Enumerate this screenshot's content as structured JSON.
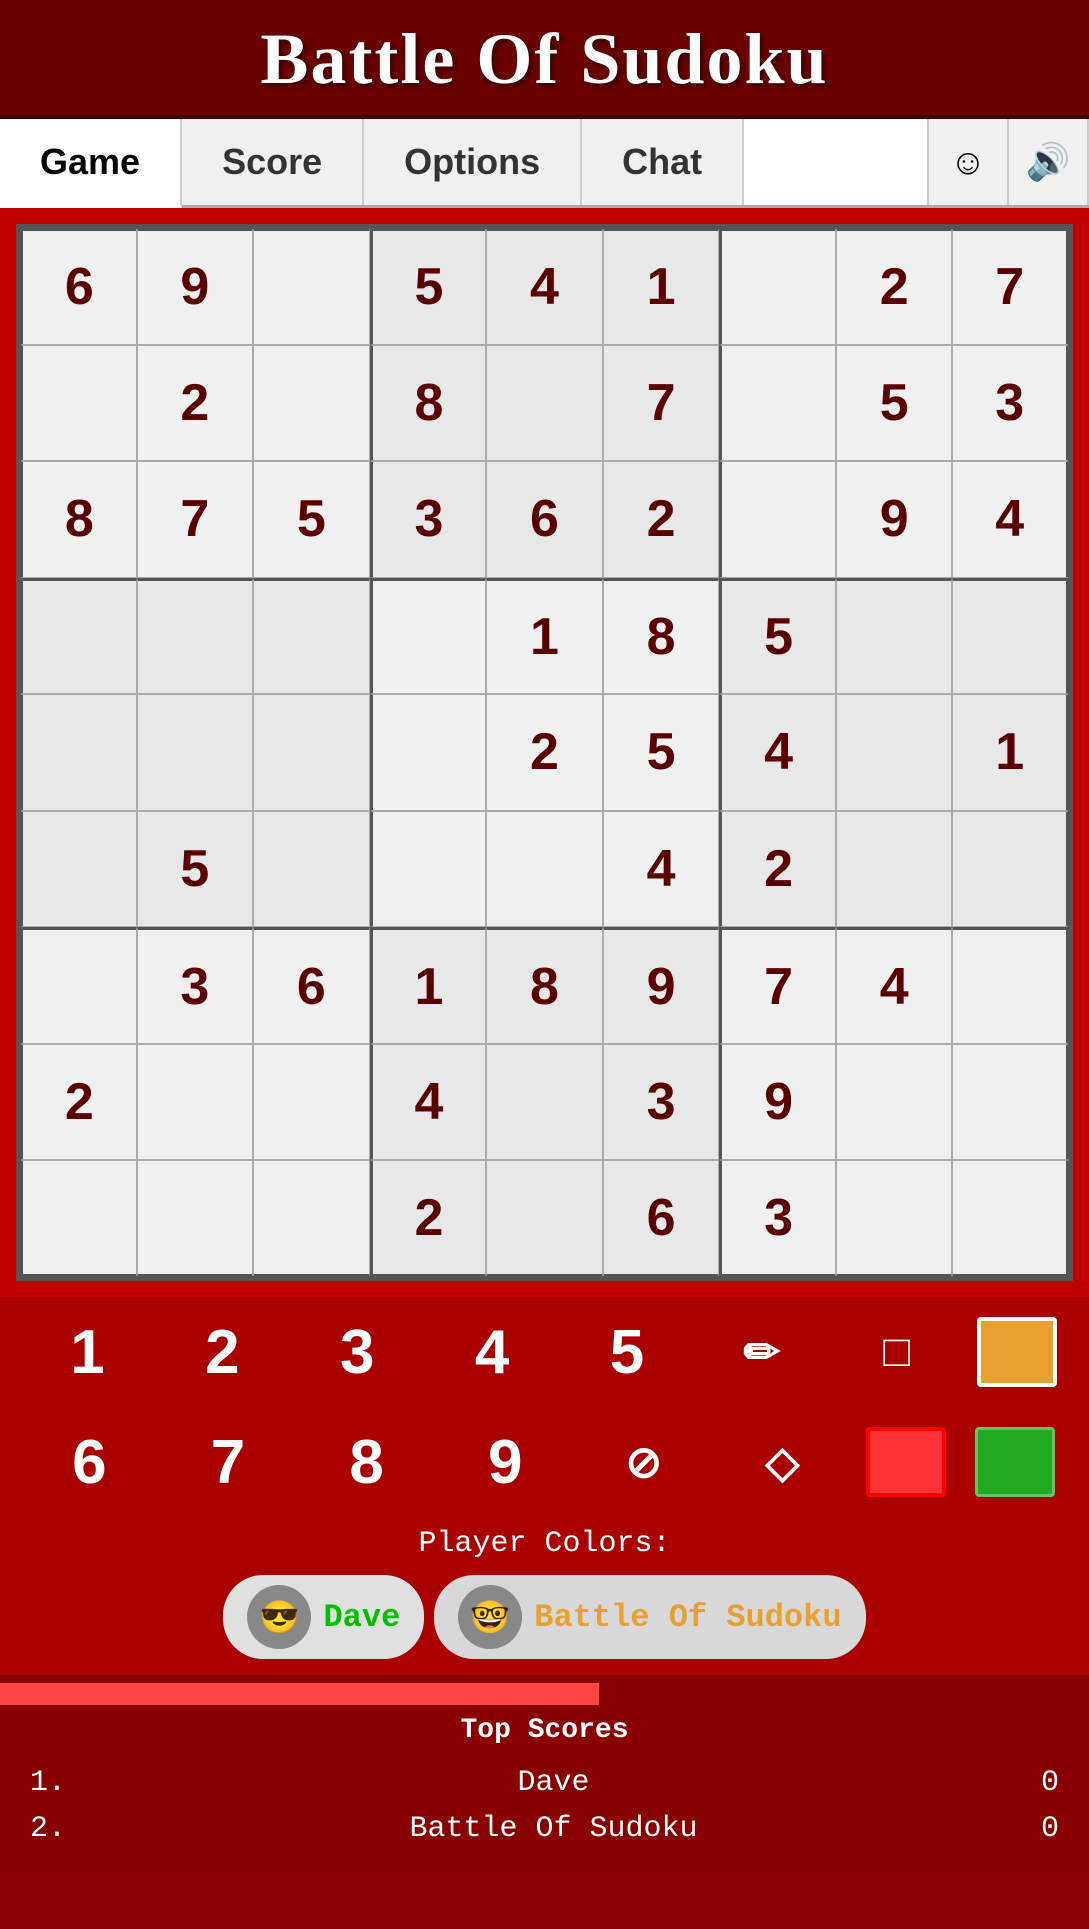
{
  "header": {
    "title": "Battle Of Sudoku"
  },
  "nav": {
    "tabs": [
      {
        "id": "game",
        "label": "Game",
        "active": true
      },
      {
        "id": "score",
        "label": "Score",
        "active": false
      },
      {
        "id": "options",
        "label": "Options",
        "active": false
      },
      {
        "id": "chat",
        "label": "Chat",
        "active": false
      }
    ],
    "emoji_icon": "☺",
    "sound_icon": "🔊"
  },
  "sudoku": {
    "grid": [
      [
        "6",
        "9",
        "",
        "5",
        "4",
        "1",
        "",
        "2",
        "7"
      ],
      [
        "",
        "2",
        "",
        "8",
        "",
        "7",
        "",
        "5",
        "3"
      ],
      [
        "8",
        "7",
        "5",
        "3",
        "6",
        "2",
        "",
        "9",
        "4"
      ],
      [
        "",
        "",
        "",
        "",
        "1",
        "8",
        "5",
        "",
        ""
      ],
      [
        "",
        "",
        "",
        "",
        "2",
        "5",
        "4",
        "",
        "1"
      ],
      [
        "",
        "5",
        "",
        "",
        "",
        "4",
        "2",
        "",
        ""
      ],
      [
        "",
        "3",
        "6",
        "1",
        "8",
        "9",
        "7",
        "4",
        ""
      ],
      [
        "2",
        "",
        "",
        "4",
        "",
        "3",
        "9",
        "",
        ""
      ],
      [
        "",
        "",
        "",
        "2",
        "",
        "6",
        "3",
        "",
        ""
      ]
    ]
  },
  "numpad": {
    "row1": [
      "1",
      "2",
      "3",
      "4",
      "5"
    ],
    "row1_tools": [
      "✏",
      "□"
    ],
    "row1_color": "orange",
    "row2": [
      "6",
      "7",
      "8",
      "9"
    ],
    "row2_tools": [
      "⊘",
      "◇"
    ],
    "row2_colors": [
      "black",
      "green"
    ]
  },
  "player_colors": {
    "label": "Player Colors:",
    "players": [
      {
        "name": "Dave",
        "color": "green",
        "avatar": "😎"
      },
      {
        "name": "Battle Of Sudoku",
        "color": "orange",
        "avatar": "🤓"
      }
    ]
  },
  "top_scores": {
    "title": "Top Scores",
    "rows": [
      {
        "rank": "1.",
        "name": "Dave",
        "score": "0"
      },
      {
        "rank": "2.",
        "name": "Battle Of Sudoku",
        "score": "0"
      }
    ]
  }
}
